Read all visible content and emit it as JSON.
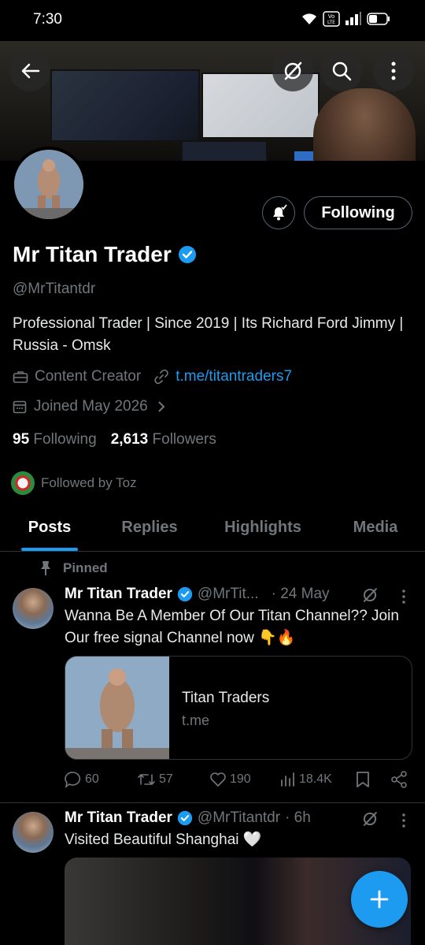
{
  "status": {
    "time": "7:30"
  },
  "profile": {
    "name": "Mr Titan Trader",
    "handle": "@MrTitantdr",
    "bio": "Professional Trader | Since 2019 | Its Richard Ford Jimmy | Russia - Omsk",
    "category": "Content Creator",
    "link": "t.me/titantraders7",
    "joined": "Joined May 2026",
    "following_count": "95",
    "following_label": "Following",
    "followers_count": "2,613",
    "followers_label": "Followers",
    "followed_by": "Followed by Toz",
    "follow_button": "Following"
  },
  "tabs": [
    "Posts",
    "Replies",
    "Highlights",
    "Media"
  ],
  "pinned_label": "Pinned",
  "posts": [
    {
      "name": "Mr Titan Trader",
      "handle": "@MrTit...",
      "time": "· 24 May",
      "text": "Wanna Be A Member Of Our Titan Channel?? Join Our free signal Channel  now 👇🔥",
      "card_title": "Titan Traders",
      "card_domain": "t.me",
      "replies": "60",
      "reposts": "57",
      "likes": "190",
      "views": "18.4K"
    },
    {
      "name": "Mr Titan Trader",
      "handle": "@MrTitantdr",
      "time": "· 6h",
      "text": "Visited Beautiful Shanghai 🤍"
    }
  ],
  "colors": {
    "accent": "#1d9bf0",
    "muted": "#71767b",
    "border": "#2f3336"
  }
}
